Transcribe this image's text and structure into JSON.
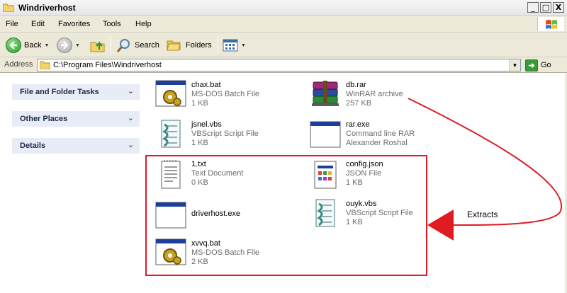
{
  "window": {
    "title": "Windriverhost",
    "buttons": {
      "minimize": "_",
      "maximize": "□",
      "close": "X"
    }
  },
  "menubar": {
    "items": [
      "File",
      "Edit",
      "Favorites",
      "Tools",
      "Help"
    ]
  },
  "toolbar": {
    "back_label": "Back",
    "search_label": "Search",
    "folders_label": "Folders"
  },
  "address": {
    "label": "Address",
    "value": "C:\\Program Files\\Windriverhost",
    "go_label": "Go"
  },
  "left_panels": [
    {
      "title": "File and Folder Tasks"
    },
    {
      "title": "Other Places"
    },
    {
      "title": "Details"
    }
  ],
  "files": [
    {
      "name": "chax.bat",
      "type": "MS-DOS Batch File",
      "size": "1 KB",
      "icon": "batch-file-icon"
    },
    {
      "name": "db.rar",
      "type": "WinRAR archive",
      "size": "257 KB",
      "icon": "winrar-archive-icon"
    },
    {
      "name": "jsnel.vbs",
      "type": "VBScript Script File",
      "size": "1 KB",
      "icon": "vbscript-icon"
    },
    {
      "name": "rar.exe",
      "type": "Command line RAR",
      "size": "Alexander Roshal",
      "icon": "exe-window-icon"
    },
    {
      "name": "1.txt",
      "type": "Text Document",
      "size": "0 KB",
      "icon": "text-document-icon"
    },
    {
      "name": "config.json",
      "type": "JSON File",
      "size": "1 KB",
      "icon": "json-file-icon"
    },
    {
      "name": "driverhost.exe",
      "type": "",
      "size": "",
      "icon": "exe-window-icon"
    },
    {
      "name": "ouyk.vbs",
      "type": "VBScript Script File",
      "size": "1 KB",
      "icon": "vbscript-icon"
    },
    {
      "name": "xvvq.bat",
      "type": "MS-DOS Batch File",
      "size": "2 KB",
      "icon": "batch-file-icon"
    }
  ],
  "annotation": {
    "label": "Extracts",
    "color": "#e01b22"
  }
}
